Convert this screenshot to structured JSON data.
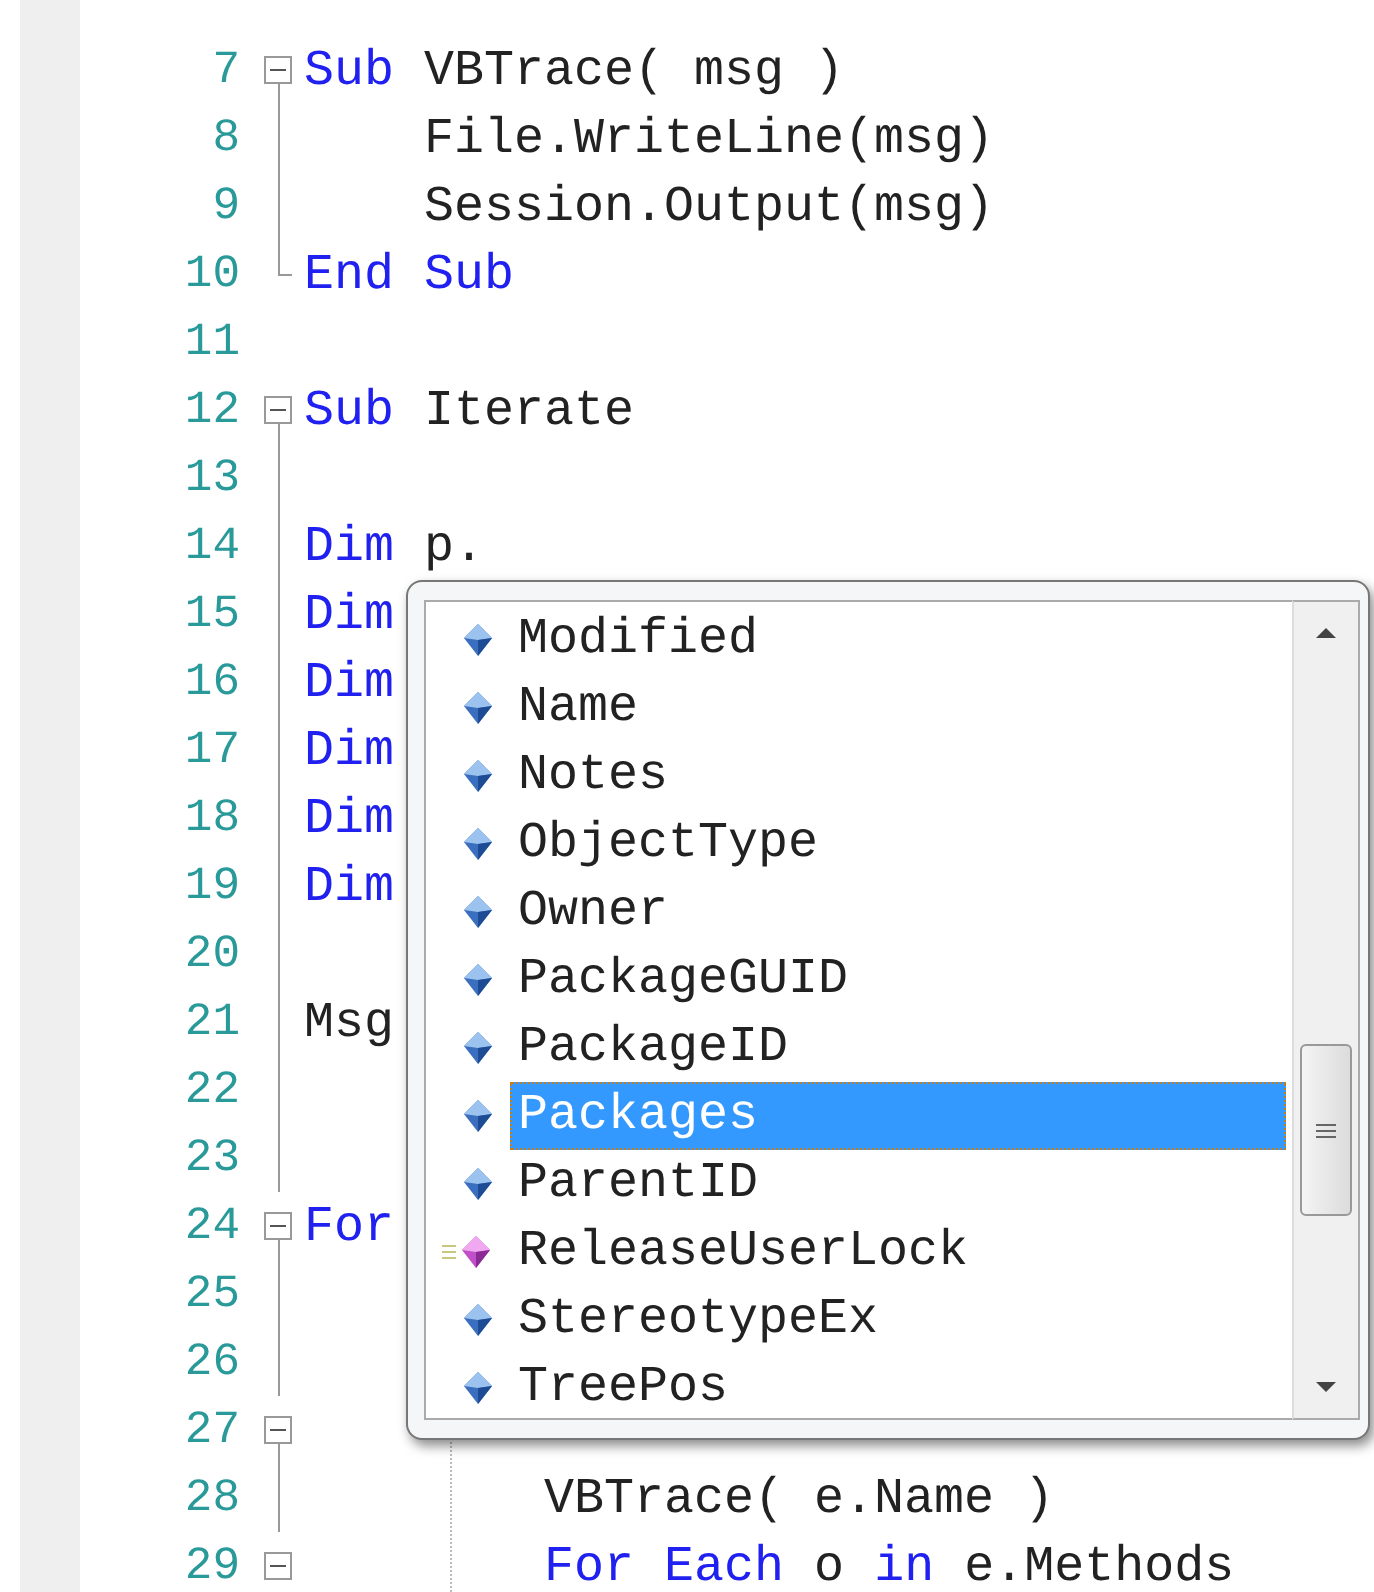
{
  "editor": {
    "lines": [
      {
        "number": "7",
        "expanded": true,
        "tokens": [
          {
            "text": "Sub",
            "kind": "keyword"
          },
          {
            "text": " VBTrace( msg )",
            "kind": "plain"
          }
        ]
      },
      {
        "number": "8",
        "tokens": [
          {
            "text": "    File.WriteLine(msg)",
            "kind": "plain"
          }
        ]
      },
      {
        "number": "9",
        "tokens": [
          {
            "text": "    Session.Output(msg)",
            "kind": "plain"
          }
        ]
      },
      {
        "number": "10",
        "block_end": true,
        "tokens": [
          {
            "text": "End ",
            "kind": "keyword"
          },
          {
            "text": "Sub",
            "kind": "keyword"
          }
        ]
      },
      {
        "number": "11"
      },
      {
        "number": "12",
        "expanded": true,
        "tokens": [
          {
            "text": "Sub",
            "kind": "keyword"
          },
          {
            "text": " Iterate",
            "kind": "plain"
          }
        ]
      },
      {
        "number": "13"
      },
      {
        "number": "14",
        "tokens": [
          {
            "text": "Dim",
            "kind": "keyword"
          },
          {
            "text": " p.",
            "kind": "plain"
          }
        ]
      },
      {
        "number": "15",
        "tokens": [
          {
            "text": "Dim",
            "kind": "keyword"
          }
        ]
      },
      {
        "number": "16",
        "tokens": [
          {
            "text": "Dim",
            "kind": "keyword"
          }
        ]
      },
      {
        "number": "17",
        "tokens": [
          {
            "text": "Dim",
            "kind": "keyword"
          }
        ]
      },
      {
        "number": "18",
        "tokens": [
          {
            "text": "Dim",
            "kind": "keyword"
          }
        ]
      },
      {
        "number": "19",
        "tokens": [
          {
            "text": "Dim",
            "kind": "keyword"
          }
        ]
      },
      {
        "number": "20"
      },
      {
        "number": "21",
        "tokens": [
          {
            "text": "Msg",
            "kind": "plain"
          }
        ]
      },
      {
        "number": "22"
      },
      {
        "number": "23"
      },
      {
        "number": "24",
        "expanded": true,
        "tokens": [
          {
            "text": "For",
            "kind": "keyword"
          }
        ]
      },
      {
        "number": "25"
      },
      {
        "number": "26"
      },
      {
        "number": "27",
        "expanded": true
      },
      {
        "number": "28",
        "tokens": [
          {
            "text": "        VBTrace( e.Name )",
            "kind": "plain"
          }
        ]
      },
      {
        "number": "29",
        "expanded": true,
        "tokens": [
          {
            "text": "        For ",
            "kind": "keyword"
          },
          {
            "text": "Each",
            "kind": "keyword"
          },
          {
            "text": " o ",
            "kind": "plain"
          },
          {
            "text": "in",
            "kind": "keyword"
          },
          {
            "text": " e.Methods",
            "kind": "plain"
          }
        ]
      }
    ]
  },
  "completion_list": {
    "items": [
      {
        "label": "Modified",
        "kind": "property",
        "selected": false
      },
      {
        "label": "Name",
        "kind": "property",
        "selected": false
      },
      {
        "label": "Notes",
        "kind": "property",
        "selected": false
      },
      {
        "label": "ObjectType",
        "kind": "property",
        "selected": false
      },
      {
        "label": "Owner",
        "kind": "property",
        "selected": false
      },
      {
        "label": "PackageGUID",
        "kind": "property",
        "selected": false
      },
      {
        "label": "PackageID",
        "kind": "property",
        "selected": false
      },
      {
        "label": "Packages",
        "kind": "property",
        "selected": true
      },
      {
        "label": "ParentID",
        "kind": "property",
        "selected": false
      },
      {
        "label": "ReleaseUserLock",
        "kind": "method",
        "selected": false
      },
      {
        "label": "StereotypeEx",
        "kind": "property",
        "selected": false
      },
      {
        "label": "TreePos",
        "kind": "property",
        "selected": false
      }
    ]
  }
}
